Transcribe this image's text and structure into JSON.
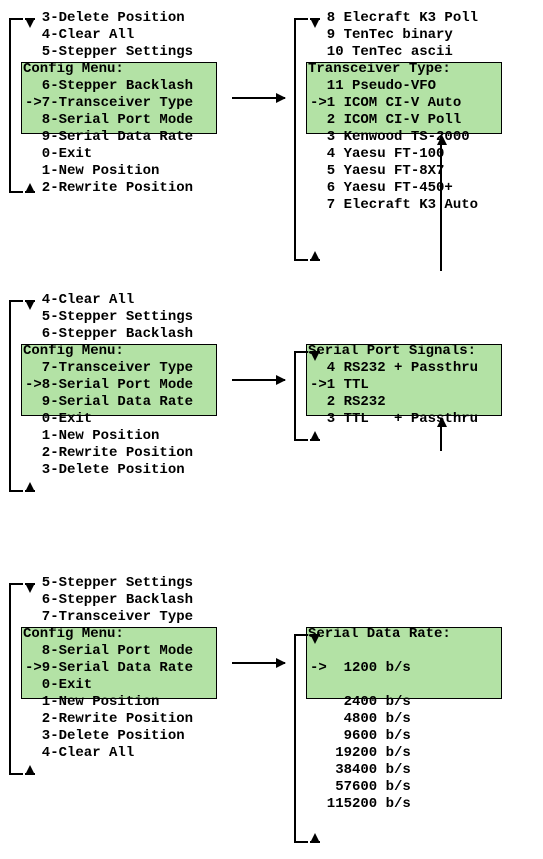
{
  "panels": [
    {
      "left": {
        "pre": [
          "  3-Delete Position",
          "  4-Clear All",
          "  5-Stepper Settings"
        ],
        "box_title": "Config Menu:",
        "box": [
          "  6-Stepper Backlash",
          "->7-Transceiver Type",
          "  8-Serial Port Mode"
        ],
        "post": [
          "  9-Serial Data Rate",
          "  0-Exit",
          "  1-New Position",
          "  2-Rewrite Position"
        ]
      },
      "right": {
        "pre": [
          "  8 Elecraft K3 Poll",
          "  9 TenTec binary",
          "  10 TenTec ascii"
        ],
        "box_title": "Transceiver Type:",
        "box": [
          "  11 Pseudo-VFO",
          "->1 ICOM CI-V Auto",
          "  2 ICOM CI-V Poll"
        ],
        "post": [
          "  3 Kenwood TS-2000",
          "  4 Yaesu FT-100",
          "  5 Yaesu FT-8X7",
          "  6 Yaesu FT-450+",
          "  7 Elecraft K3 Auto"
        ]
      }
    },
    {
      "left": {
        "pre": [
          "  4-Clear All",
          "  5-Stepper Settings",
          "  6-Stepper Backlash"
        ],
        "box_title": "Config Menu:",
        "box": [
          "  7-Transceiver Type",
          "->8-Serial Port Mode",
          "  9-Serial Data Rate"
        ],
        "post": [
          "  0-Exit",
          "  1-New Position",
          "  2-Rewrite Position",
          "  3-Delete Position"
        ]
      },
      "right": {
        "pre": [],
        "box_title": "Serial Port Signals:",
        "box": [
          "  4 RS232 + Passthru",
          "->1 TTL",
          "  2 RS232"
        ],
        "post": [
          "  3 TTL   + Passthru"
        ]
      }
    },
    {
      "left": {
        "pre": [
          "  5-Stepper Settings",
          "  6-Stepper Backlash",
          "  7-Transceiver Type"
        ],
        "box_title": "Config Menu:",
        "box": [
          "  8-Serial Port Mode",
          "->9-Serial Data Rate",
          "  0-Exit"
        ],
        "post": [
          "  1-New Position",
          "  2-Rewrite Position",
          "  3-Delete Position",
          "  4-Clear All"
        ]
      },
      "right": {
        "pre": [],
        "box_title": "Serial Data Rate:",
        "box": [
          "",
          "->  1200 b/s",
          ""
        ],
        "post": [
          "    2400 b/s",
          "    4800 b/s",
          "    9600 b/s",
          "   19200 b/s",
          "   38400 b/s",
          "   57600 b/s",
          "  115200 b/s"
        ]
      }
    }
  ]
}
